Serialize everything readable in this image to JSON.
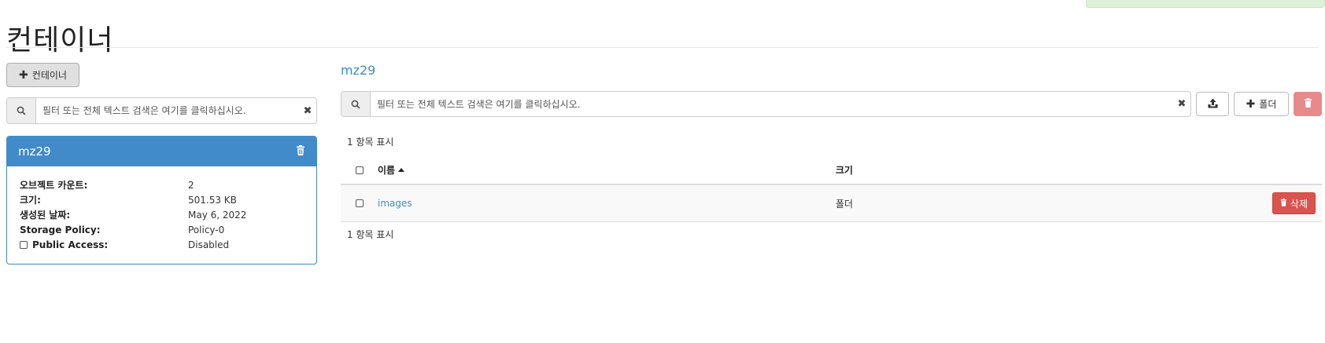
{
  "page": {
    "title": "컨테이너"
  },
  "left": {
    "add_container_label": "컨테이너",
    "search_placeholder": "필터 또는 전체 텍스트 검색은 여기를 클릭하십시오.",
    "container": {
      "name": "mz29",
      "properties": [
        {
          "key": "오브젝트 카운트:",
          "value": "2"
        },
        {
          "key": "크기:",
          "value": "501.53 KB"
        },
        {
          "key": "생성된 날짜:",
          "value": "May 6, 2022"
        },
        {
          "key": "Storage Policy:",
          "value": "Policy-0"
        },
        {
          "key": "Public Access:",
          "value": "Disabled"
        }
      ]
    }
  },
  "right": {
    "breadcrumb": "mz29",
    "search_placeholder": "필터 또는 전체 텍스트 검색은 여기를 클릭하십시오.",
    "folder_button_label": "폴더",
    "count_text": "1 항목 표시",
    "table": {
      "headers": {
        "name": "이름",
        "size": "크기"
      },
      "rows": [
        {
          "name": "images",
          "size": "폴더",
          "action": "삭제"
        }
      ]
    },
    "colors": {
      "accent": "#428bca",
      "danger": "#d9534f",
      "danger_disabled": "#e8898a"
    }
  }
}
